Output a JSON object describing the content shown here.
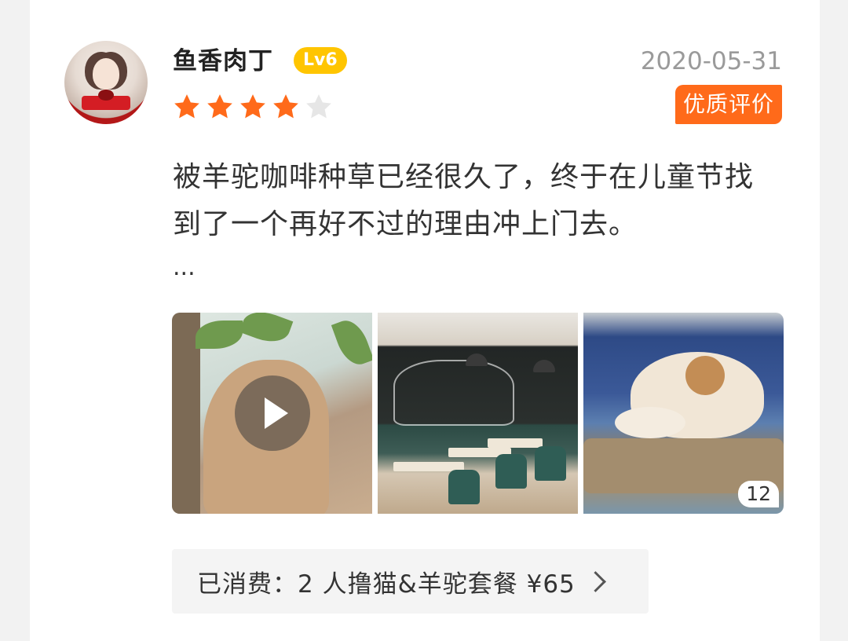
{
  "review": {
    "username": "鱼香肉丁",
    "level": "Lv6",
    "date": "2020-05-31",
    "rating": 4,
    "max_rating": 5,
    "quality_badge": "优质评价",
    "text": "被羊驼咖啡种草已经很久了，终于在儿童节找到了一个再好不过的理由冲上门去。",
    "ellipsis": "...",
    "photos": {
      "more_count": "12"
    },
    "purchase": {
      "label": "已消费：2 人撸猫&羊驼套餐 ¥65"
    }
  },
  "colors": {
    "star_filled": "#ff6a1a",
    "star_empty": "#e6e6e6",
    "level_badge": "#ffc500",
    "quality_badge": "#ff6a1a"
  },
  "icons": [
    "star-icon",
    "play-icon",
    "chevron-right-icon"
  ]
}
